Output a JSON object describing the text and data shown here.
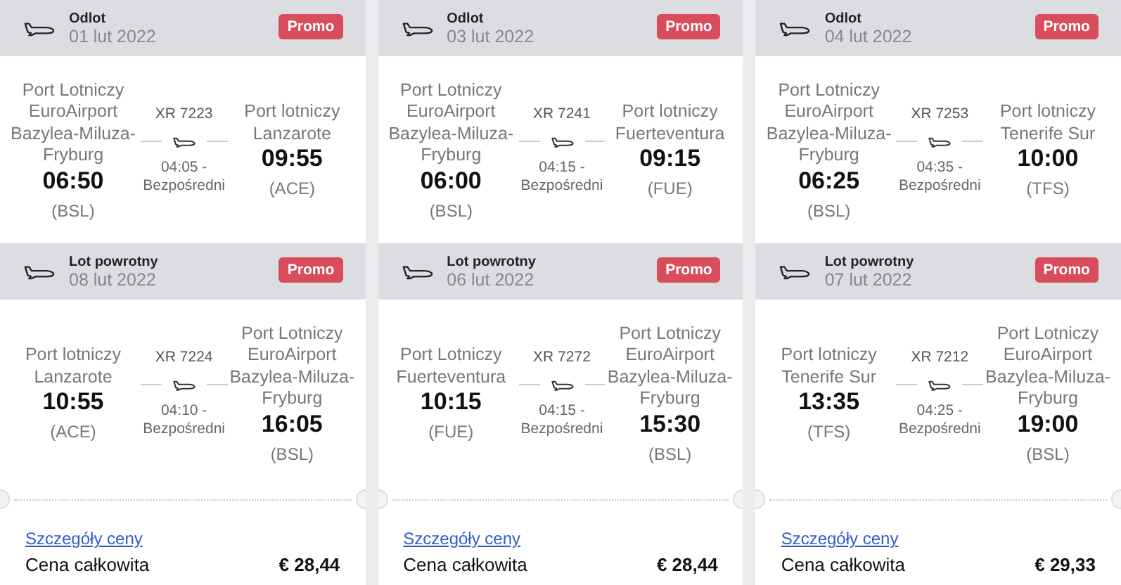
{
  "offers": [
    {
      "legs": [
        {
          "label": "Odlot",
          "date": "01 lut 2022",
          "badge": "Promo",
          "from": {
            "airport": "Port Lotniczy EuroAirport Bazylea-Miluza-Fryburg",
            "time": "06:50",
            "code": "(BSL)"
          },
          "flight": "XR 7223",
          "duration": "04:05 -",
          "stops": "Bezpośredni",
          "to": {
            "airport": "Port lotniczy Lanzarote",
            "time": "09:55",
            "code": "(ACE)"
          }
        },
        {
          "label": "Lot powrotny",
          "date": "08 lut 2022",
          "badge": "Promo",
          "from": {
            "airport": "Port lotniczy Lanzarote",
            "time": "10:55",
            "code": "(ACE)"
          },
          "flight": "XR 7224",
          "duration": "04:10 -",
          "stops": "Bezpośredni",
          "to": {
            "airport": "Port Lotniczy EuroAirport Bazylea-Miluza-Fryburg",
            "time": "16:05",
            "code": "(BSL)"
          }
        }
      ],
      "price_link": "Szczegóły ceny",
      "total_label": "Cena całkowita",
      "total": "€ 28,44"
    },
    {
      "legs": [
        {
          "label": "Odlot",
          "date": "03 lut 2022",
          "badge": "Promo",
          "from": {
            "airport": "Port Lotniczy EuroAirport Bazylea-Miluza-Fryburg",
            "time": "06:00",
            "code": "(BSL)"
          },
          "flight": "XR 7241",
          "duration": "04:15 -",
          "stops": "Bezpośredni",
          "to": {
            "airport": "Port lotniczy Fuerteventura",
            "time": "09:15",
            "code": "(FUE)"
          }
        },
        {
          "label": "Lot powrotny",
          "date": "06 lut 2022",
          "badge": "Promo",
          "from": {
            "airport": "Port Lotniczy Fuerteventura",
            "time": "10:15",
            "code": "(FUE)"
          },
          "flight": "XR 7272",
          "duration": "04:15 -",
          "stops": "Bezpośredni",
          "to": {
            "airport": "Port Lotniczy EuroAirport Bazylea-Miluza-Fryburg",
            "time": "15:30",
            "code": "(BSL)"
          }
        }
      ],
      "price_link": "Szczegóły ceny",
      "total_label": "Cena całkowita",
      "total": "€ 28,44"
    },
    {
      "legs": [
        {
          "label": "Odlot",
          "date": "04 lut 2022",
          "badge": "Promo",
          "from": {
            "airport": "Port Lotniczy EuroAirport Bazylea-Miluza-Fryburg",
            "time": "06:25",
            "code": "(BSL)"
          },
          "flight": "XR 7253",
          "duration": "04:35 -",
          "stops": "Bezpośredni",
          "to": {
            "airport": "Port lotniczy Tenerife Sur",
            "time": "10:00",
            "code": "(TFS)"
          }
        },
        {
          "label": "Lot powrotny",
          "date": "07 lut 2022",
          "badge": "Promo",
          "from": {
            "airport": "Port lotniczy Tenerife Sur",
            "time": "13:35",
            "code": "(TFS)"
          },
          "flight": "XR 7212",
          "duration": "04:25 -",
          "stops": "Bezpośredni",
          "to": {
            "airport": "Port Lotniczy EuroAirport Bazylea-Miluza-Fryburg",
            "time": "19:00",
            "code": "(BSL)"
          }
        }
      ],
      "price_link": "Szczegóły ceny",
      "total_label": "Cena całkowita",
      "total": "€ 29,33"
    }
  ]
}
